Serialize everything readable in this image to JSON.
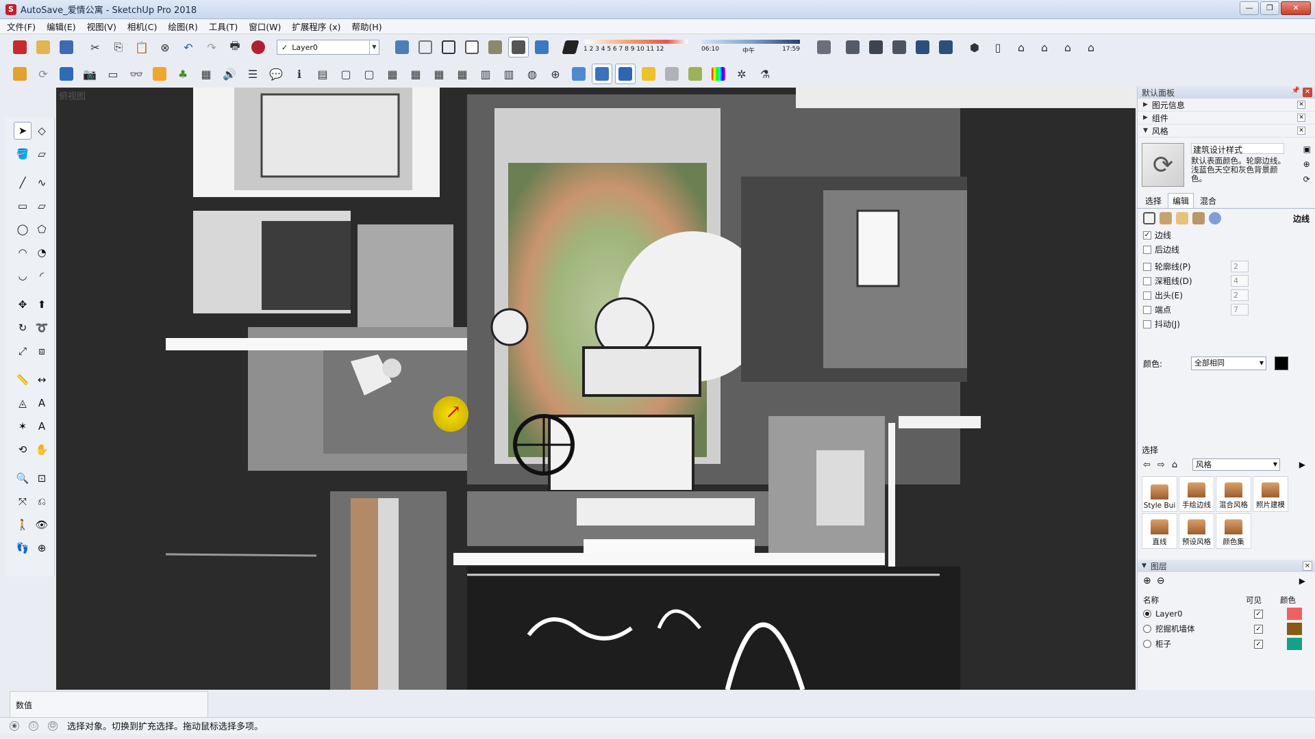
{
  "window": {
    "title": "AutoSave_爱情公寓 - SketchUp Pro 2018"
  },
  "menu": [
    "文件(F)",
    "编辑(E)",
    "视图(V)",
    "相机(C)",
    "绘图(R)",
    "工具(T)",
    "窗口(W)",
    "扩展程序 (x)",
    "帮助(H)"
  ],
  "toolbar": {
    "layer_dropdown": "Layer0",
    "shadow_months": "1 2 3 4 5 6 7 8 9 10 11 12",
    "time_start": "06:10",
    "time_mid": "中午",
    "time_end": "17:59"
  },
  "viewport": {
    "label": "俯视图"
  },
  "panel": {
    "title": "默认面板",
    "trays": [
      "图元信息",
      "组件",
      "风格"
    ],
    "style": {
      "name": "建筑设计样式",
      "description": "默认表面颜色。轮廓边线。浅蓝色天空和灰色背景颜色。"
    },
    "tabs": [
      "选择",
      "编辑",
      "混合"
    ],
    "edge_section_label": "边线",
    "options": [
      {
        "label": "边线",
        "checked": true
      },
      {
        "label": "后边线",
        "checked": false
      },
      {
        "label": "轮廓线(P)",
        "checked": false,
        "value": "2"
      },
      {
        "label": "深粗线(D)",
        "checked": false,
        "value": "4"
      },
      {
        "label": "出头(E)",
        "checked": false,
        "value": "2"
      },
      {
        "label": "端点",
        "checked": false,
        "value": "7"
      },
      {
        "label": "抖动(J)",
        "checked": false
      }
    ],
    "color_label": "颜色:",
    "color_value": "全部相同",
    "select_section": "选择",
    "collection": "风格",
    "styles": [
      "Style Bui",
      "手绘边线",
      "混合风格",
      "照片建模",
      "直线",
      "预设风格",
      "颜色集"
    ],
    "layers_title": "图层",
    "layer_columns": {
      "name": "名称",
      "visible": "可见",
      "color": "颜色"
    },
    "layers": [
      {
        "name": "Layer0",
        "active": true,
        "visible": true,
        "color": "#f16060"
      },
      {
        "name": "挖掘机墙体",
        "active": false,
        "visible": true,
        "color": "#8a5a12"
      },
      {
        "name": "柜子",
        "active": false,
        "visible": true,
        "color": "#16a088"
      }
    ]
  },
  "measure_label": "数值",
  "status_text": "选择对象。切换到扩充选择。拖动鼠标选择多项。"
}
